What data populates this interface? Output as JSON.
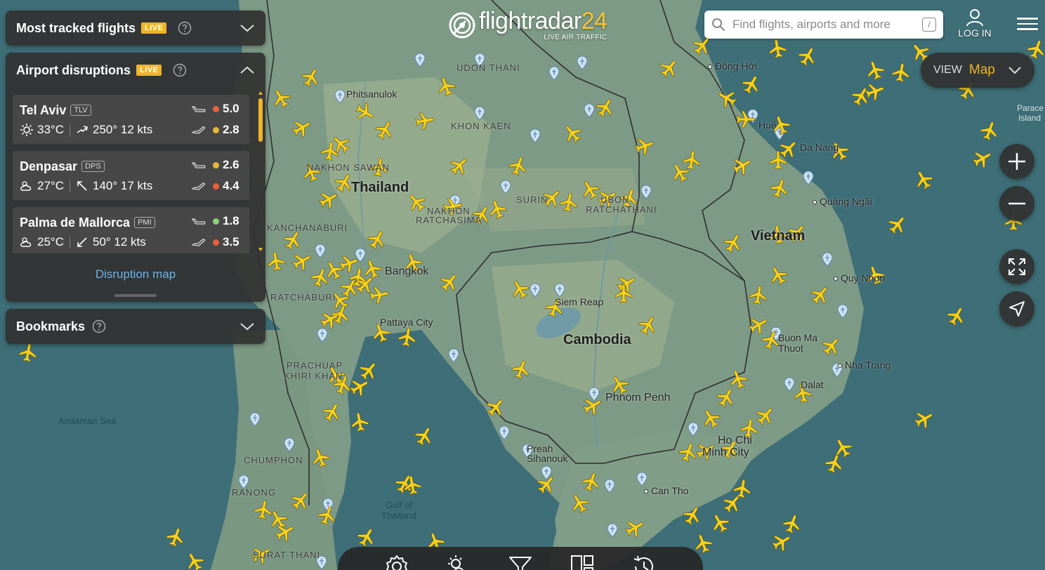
{
  "app": {
    "brand_name": "flightradar",
    "brand_number": "24",
    "brand_tagline": "LIVE AIR TRAFFIC"
  },
  "search": {
    "placeholder": "Find flights, airports and more",
    "shortcut": "/"
  },
  "header": {
    "login_label": "LOG IN"
  },
  "panels": {
    "most_tracked": {
      "title": "Most tracked flights",
      "badge": "LIVE"
    },
    "disruptions": {
      "title": "Airport disruptions",
      "badge": "LIVE",
      "link": "Disruption map",
      "airports": [
        {
          "name": "Tel Aviv",
          "code": "TLV",
          "weather": "sunny",
          "temp": "33°C",
          "wind": "250° 12 kts",
          "dep": "5.0",
          "arr": "2.8",
          "dep_color": "#e8603c",
          "arr_color": "#e6b83a"
        },
        {
          "name": "Denpasar",
          "code": "DPS",
          "weather": "partly-cloudy",
          "temp": "27°C",
          "wind": "140° 17 kts",
          "dep": "2.6",
          "arr": "4.4",
          "dep_color": "#e6b83a",
          "arr_color": "#e8603c"
        },
        {
          "name": "Palma de Mallorca",
          "code": "PMI",
          "weather": "partly-cloudy",
          "temp": "25°C",
          "wind": "50° 12 kts",
          "dep": "1.8",
          "arr": "3.5",
          "dep_color": "#8fd07a",
          "arr_color": "#e8603c"
        }
      ]
    },
    "bookmarks": {
      "title": "Bookmarks"
    }
  },
  "view": {
    "label": "VIEW",
    "value": "Map"
  },
  "colors": {
    "accent": "#f0b429",
    "panel_bg": "#323232",
    "link": "#6eb3e6",
    "aircraft": "#f7d21b"
  },
  "map": {
    "countries": [
      "Thailand",
      "Cambodia",
      "Vietnam"
    ],
    "regions": [
      "UDON THANI",
      "KHON KAEN",
      "NAKHON SAWAN",
      "NAKHON RATCHASIMA",
      "SURIN",
      "UBON RATCHATHANI",
      "KANCHANABURI",
      "RATCHABURI",
      "PRACHUAP KHIRI KHAN",
      "CHUMPHON",
      "RANONG",
      "SURAT THANI"
    ],
    "cities": [
      "Phitsanulok",
      "Bangkok",
      "Pattaya City",
      "Siem Reap",
      "Phnom Penh",
      "Preah Sihanouk",
      "Can Tho",
      "Ho Chi Minh City",
      "Buon Ma Thuot",
      "Nha Trang",
      "Dalat",
      "Quy Nhon",
      "Quang Ngai",
      "Da Nang",
      "Hue",
      "Dong Hoi"
    ],
    "seas": [
      "Andaman Sea",
      "Gulf of Thailand"
    ],
    "labels": {
      "udon": "UDON THANI",
      "khonkaen": "KHON KAEN",
      "nakhonsawan": "NAKHON SAWAN",
      "thailand": "Thailand",
      "nakhon_r1": "NAKHON",
      "nakhon_r2": "RATCHASIMA",
      "surin": "SURIN",
      "ubon1": "UBON",
      "ubon2": "RATCHATHANI",
      "kanchanaburi": "KANCHANABURI",
      "ratchaburi": "RATCHABURI",
      "prachuap1": "PRACHUAP",
      "prachuap2": "KHIRI KHAN",
      "chumphon": "CHUMPHON",
      "ranong": "RANONG",
      "surat": "SURAT THANI",
      "phitsanulok": "Phitsanulok",
      "bangkok": "Bangkok",
      "pattaya": "Pattaya City",
      "siemreap": "Siem Reap",
      "cambodia": "Cambodia",
      "phnompenh": "Phnom Penh",
      "preah1": "Preah",
      "preah2": "Sihanouk",
      "cantho": "Can Tho",
      "hochi1": "Ho Chi",
      "hochi2": "Minh City",
      "buonma1": "Buon Ma",
      "buonma2": "Thuot",
      "nhatrang": "Nha Trang",
      "dalat": "Dalat",
      "quynhon": "Quy Nhon",
      "quangngai": "Quảng Ngãi",
      "danang": "Da Nang",
      "hue": "Huế",
      "donghoi": "Đồng Hới",
      "vietnam": "Vietnam",
      "andaman": "Andaman Sea",
      "gulf1": "Gulf of",
      "gulf2": "Thailand",
      "paracel1": "Parace",
      "paracel2": "Island"
    }
  }
}
